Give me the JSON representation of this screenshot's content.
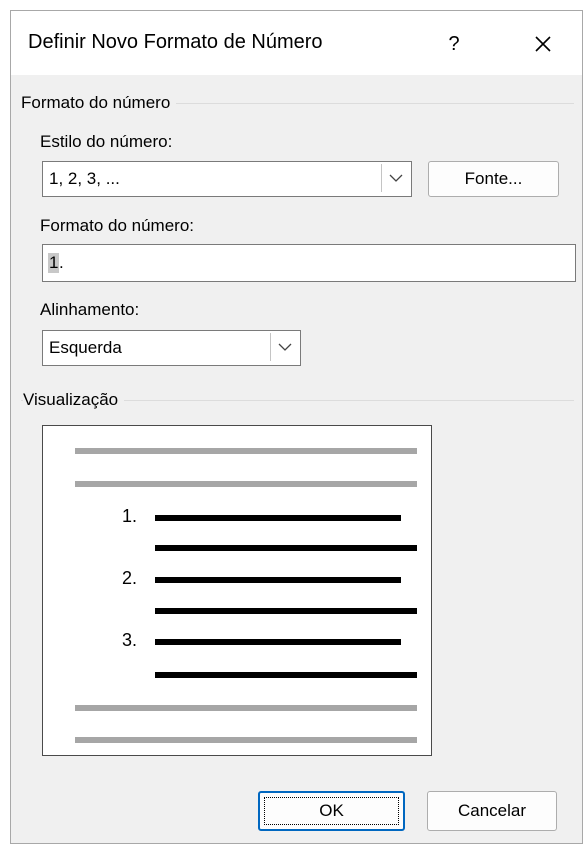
{
  "dialog": {
    "title": "Definir Novo Formato de Número",
    "help_label": "?",
    "close_icon": "close-icon"
  },
  "number_format_group": {
    "label": "Formato do número",
    "style_label": "Estilo do número:",
    "style_value": "1, 2, 3, ...",
    "font_button": "Fonte...",
    "format_label": "Formato do número:",
    "format_value_selected": "1",
    "format_value_rest": ".",
    "alignment_label": "Alinhamento:",
    "alignment_value": "Esquerda"
  },
  "preview_group": {
    "label": "Visualização",
    "numbers": [
      "1.",
      "2.",
      "3."
    ]
  },
  "buttons": {
    "ok": "OK",
    "cancel": "Cancelar"
  }
}
